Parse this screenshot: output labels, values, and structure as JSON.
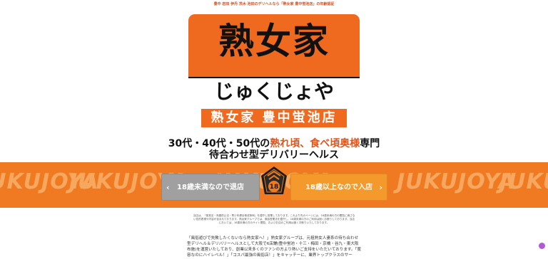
{
  "top_bar": {
    "text": "豊中 岩田 伊丹 茨木 池田のデリヘルなら「熟女家 豊中蛍池店」の年齢認証"
  },
  "logo": {
    "kanji": "熟女家",
    "kana": "じゅくじょや"
  },
  "store": {
    "name": "熟女家 豊中蛍池店"
  },
  "tagline": {
    "line1_prefix": "30代・40代・50代の",
    "line1_highlight": "熟れ頃、食べ頃奥様",
    "line1_suffix": "専門",
    "line2": "待合わせ型デリバリーヘルス"
  },
  "band": {
    "word": "JUKUJOYA"
  },
  "buttons": {
    "exit_label": "18歳未満なので退店",
    "enter_label": "18歳以上なので入店",
    "exit_chevron": "‹",
    "enter_chevron": "›"
  },
  "badge": {
    "text": "18"
  },
  "notice": {
    "text": "当店は、『風営法・売春防止法・青少年健全育成条例』を遵守し営業しております。これより先のページには、18歳未満の方の閲覧に適さない性的表現や内容が含まれております。熟女家グループでは、風俗営業法を遵守し、18歳未満の方のご利用は固くお断りしております。当店においては、18歳未満の方のサイト閲覧、およびお店のご利用は固くお断りいたしております。"
  },
  "description": {
    "text": "「風俗遊びで失敗したくないなら熟女家へ！」熟女家グループは、元祖熟女人妻系の待ち合わせ型デリヘル＆デリバリーヘルスとして大阪で6店舗(豊中蛍池・十三・梅田・京橋・谷九・東大阪布施)を運営いたしており、創業以来多くのファンの方より熱いご支持をいただいております。「寛容なのにハイレベル！」「コスパ最強の風俗店！」をキャッチーに、業界トップクラスのサー"
  },
  "colors": {
    "brand_orange": "#ef6a1f",
    "band_orange": "#f07a22",
    "exit_gray": "#a0a0a0",
    "enter_orange": "#f49a2c"
  }
}
